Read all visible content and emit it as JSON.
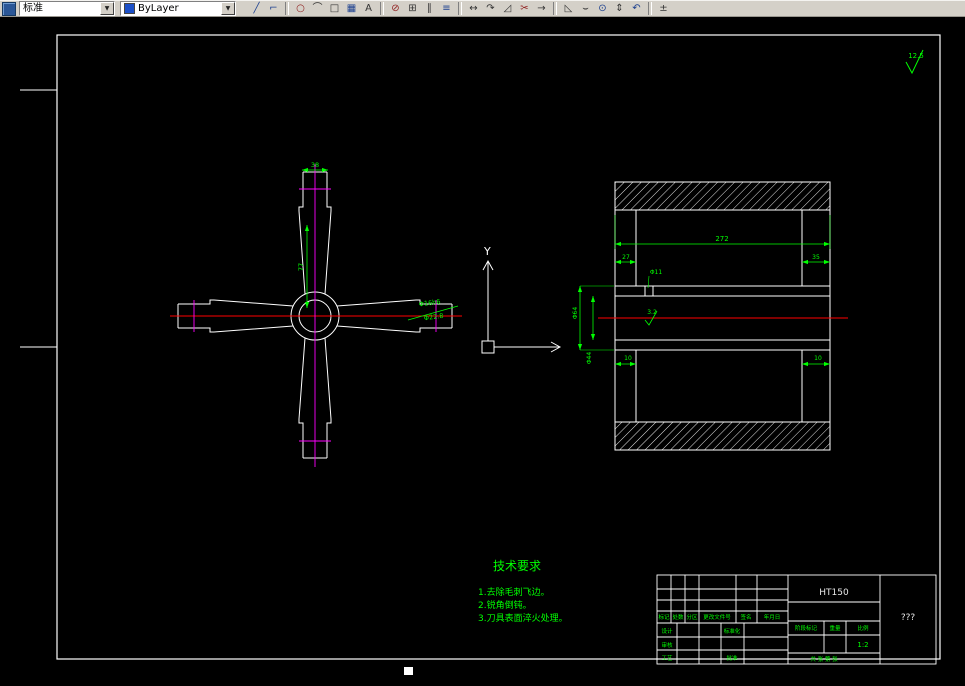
{
  "toolbar": {
    "style_combo": {
      "value": "标准"
    },
    "layer_combo": {
      "value": "ByLayer"
    },
    "dropdown_arrow": "▼",
    "groups": [
      {
        "buttons": [
          {
            "name": "draw-line-icon",
            "glyph": "╱",
            "color": "#1b3f8f"
          },
          {
            "name": "polyline-icon",
            "glyph": "⌐",
            "color": "#1b3f8f"
          }
        ]
      },
      {
        "buttons": [
          {
            "name": "circle-icon",
            "glyph": "○",
            "color": "#8f1b1b"
          },
          {
            "name": "arc-icon",
            "glyph": "⌒",
            "color": "#333333"
          },
          {
            "name": "rectangle-icon",
            "glyph": "□",
            "color": "#333333"
          },
          {
            "name": "hatch-icon",
            "glyph": "▦",
            "color": "#1b3f8f"
          },
          {
            "name": "text-icon",
            "glyph": "A",
            "color": "#333333"
          }
        ]
      },
      {
        "buttons": [
          {
            "name": "erase-icon",
            "glyph": "⊘",
            "color": "#8f1b1b"
          },
          {
            "name": "copy-icon",
            "glyph": "⊞",
            "color": "#333333"
          },
          {
            "name": "mirror-icon",
            "glyph": "∥",
            "color": "#333333"
          },
          {
            "name": "offset-icon",
            "glyph": "≡",
            "color": "#1b3f8f"
          }
        ]
      },
      {
        "buttons": [
          {
            "name": "move-icon",
            "glyph": "↔",
            "color": "#333333"
          },
          {
            "name": "rotate-icon",
            "glyph": "↷",
            "color": "#333333"
          },
          {
            "name": "scale-icon",
            "glyph": "◿",
            "color": "#333333"
          },
          {
            "name": "trim-icon",
            "glyph": "✂",
            "color": "#8f1b1b"
          },
          {
            "name": "extend-icon",
            "glyph": "→",
            "color": "#333333"
          }
        ]
      },
      {
        "buttons": [
          {
            "name": "chamfer-icon",
            "glyph": "◺",
            "color": "#333333"
          },
          {
            "name": "fillet-icon",
            "glyph": "⌣",
            "color": "#333333"
          },
          {
            "name": "zoom-icon",
            "glyph": "⊙",
            "color": "#1b3f8f"
          },
          {
            "name": "pan-icon",
            "glyph": "⇕",
            "color": "#333333"
          },
          {
            "name": "undo-icon",
            "glyph": "↶",
            "color": "#1b3f8f"
          }
        ]
      },
      {
        "buttons": [
          {
            "name": "measure-icon",
            "glyph": "±",
            "color": "#333333"
          }
        ]
      }
    ]
  },
  "sheet": {
    "roughness_global": "12.5"
  },
  "ucs": {
    "y_label": "Y"
  },
  "dims": {
    "cross": {
      "d38": "38",
      "d77": "77",
      "d16": "Φ16h6",
      "d228": "Φ22.8"
    },
    "cyl": {
      "d272": "272",
      "d27": "27",
      "d11": "Φ11",
      "d35": "35",
      "d64": "Φ64",
      "d44": "Φ44",
      "r32": "3.2",
      "d10l": "10",
      "d10r": "10"
    }
  },
  "tech": {
    "title": "技术要求",
    "items": [
      "1.去除毛刺飞边。",
      "2.锐角倒钝。",
      "3.刀具表面淬火处理。"
    ]
  },
  "title_block": {
    "material": "HT150",
    "part_name": "???",
    "scale_value": "1:2",
    "headers": {
      "mark": "标记",
      "count": "处数",
      "zone": "分区",
      "change_file": "更改文件号",
      "signature": "签名",
      "date": "年月日"
    },
    "roles": {
      "design": "设计",
      "standardization": "标准化",
      "review": "审核",
      "process": "工艺",
      "approve": "批准"
    },
    "stage_mark": "阶段标记",
    "weight": "重量",
    "scale_label": "比例",
    "sheets": "共 张 第 张"
  },
  "colors": {
    "dimension": "#00ff00",
    "centerline_red": "#ff0000",
    "centerline_magenta": "#ff00ff",
    "geometry": "#ffffff",
    "canvas": "#000000",
    "toolbar": "#d4d0c8"
  }
}
